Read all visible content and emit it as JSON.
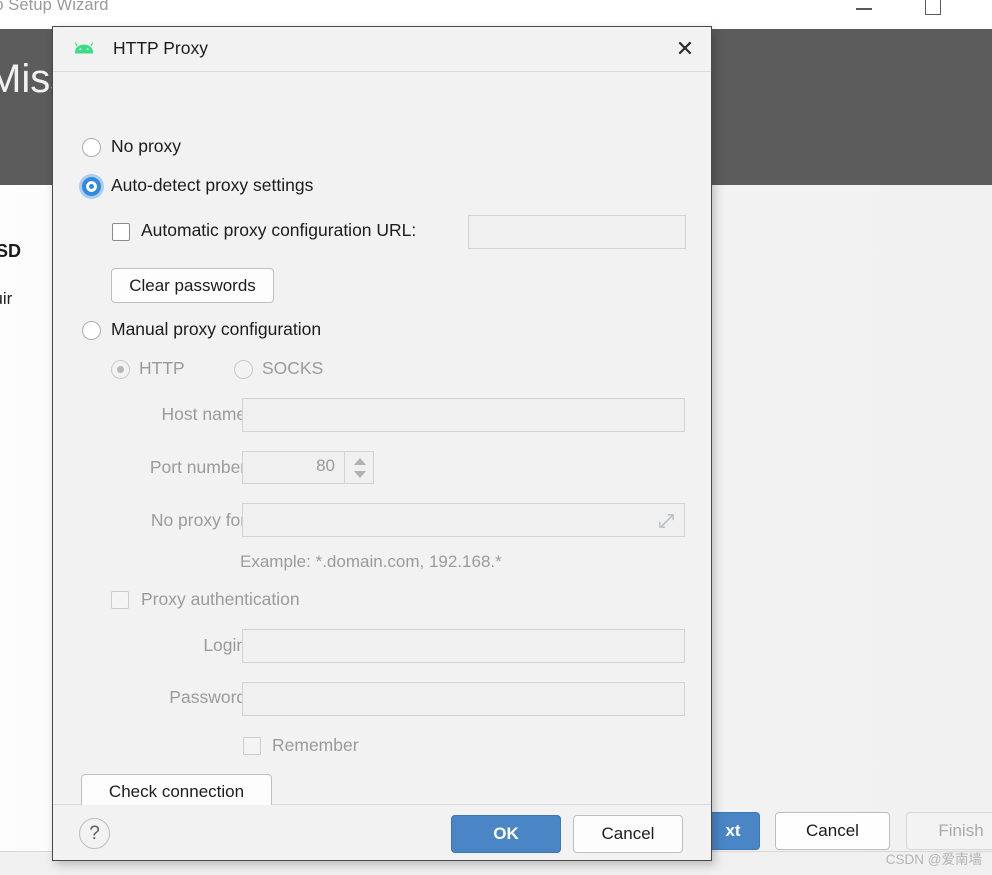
{
  "background_window": {
    "title": "udio Setup Wizard",
    "banner_title": "Miss",
    "heading": "oid SD",
    "subtext": "ntinuir",
    "minimize_icon": "minimize-icon",
    "maximize_icon": "maximize-icon",
    "buttons": {
      "next": "xt",
      "cancel": "Cancel",
      "finish": "Finish"
    }
  },
  "watermark": "CSDN @爱南墙",
  "dialog": {
    "title": "HTTP Proxy",
    "icon": "android-icon",
    "close_icon": "✕",
    "options": {
      "no_proxy": "No proxy",
      "auto_detect": "Auto-detect proxy settings",
      "manual": "Manual proxy configuration"
    },
    "auto_section": {
      "pac_checkbox_label": "Automatic proxy configuration URL:",
      "pac_url_value": "",
      "clear_passwords_label": "Clear passwords"
    },
    "manual_section": {
      "protocol_http": "HTTP",
      "protocol_socks": "SOCKS",
      "host_name_label": "Host name:",
      "host_name_value": "",
      "port_number_label": "Port number:",
      "port_number_value": "80",
      "no_proxy_for_label": "No proxy for:",
      "no_proxy_for_value": "",
      "example_hint": "Example: *.domain.com, 192.168.*",
      "proxy_auth_label": "Proxy authentication",
      "login_label": "Login:",
      "login_value": "",
      "password_label": "Password:",
      "password_value": "",
      "remember_label": "Remember"
    },
    "check_connection_label": "Check connection",
    "footer": {
      "help_label": "?",
      "ok_label": "OK",
      "cancel_label": "Cancel"
    }
  },
  "colors": {
    "accent_blue": "#4a86c5",
    "radio_selected": "#2f8ae0",
    "radio_focus_ring": "#aacdf0",
    "android_green": "#3ddc84",
    "dark_band": "#5c5c5c",
    "dialog_bg": "#f2f2f2"
  }
}
